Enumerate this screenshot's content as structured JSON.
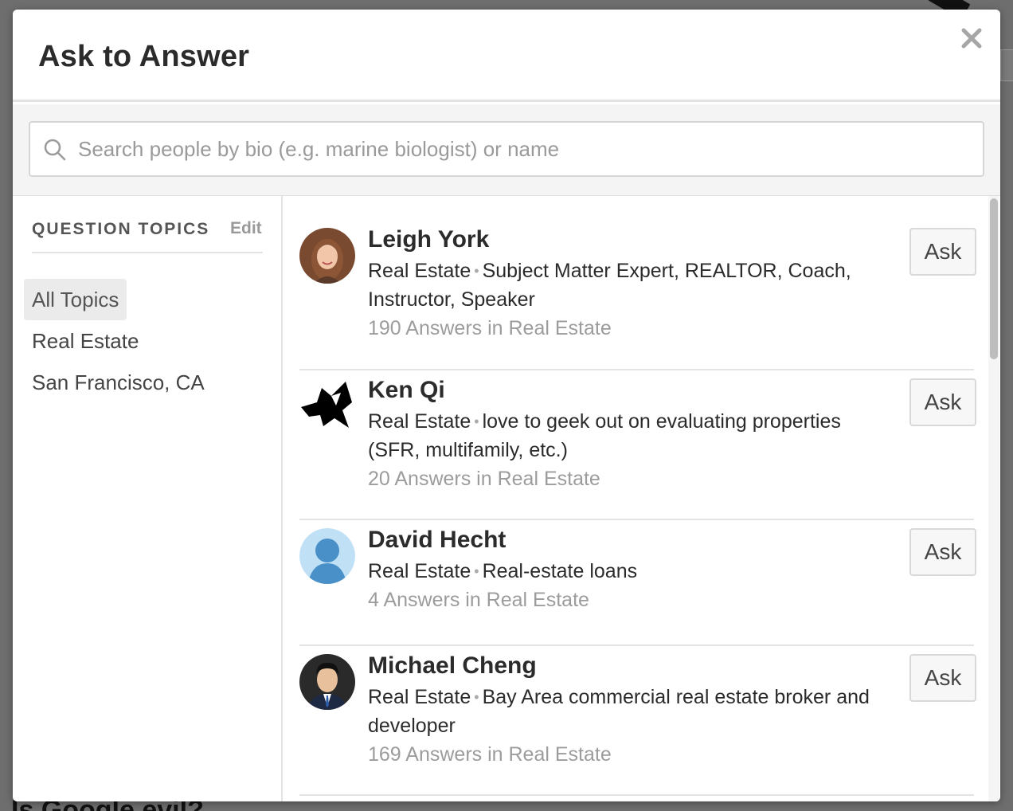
{
  "dialog": {
    "title": "Ask to Answer"
  },
  "search": {
    "placeholder": "Search people by bio (e.g. marine biologist) or name",
    "value": ""
  },
  "sidebar": {
    "heading": "QUESTION TOPICS",
    "edit_label": "Edit",
    "topics": [
      {
        "label": "All Topics",
        "selected": true
      },
      {
        "label": "Real Estate",
        "selected": false
      },
      {
        "label": "San Francisco, CA",
        "selected": false
      }
    ]
  },
  "people": [
    {
      "name": "Leigh York",
      "topic": "Real Estate",
      "bio": "Subject Matter Expert, REALTOR, Coach, Instructor, Speaker",
      "stats": "190 Answers in Real Estate",
      "action": "Ask",
      "avatar": "photo-woman"
    },
    {
      "name": "Ken Qi",
      "topic": "Real Estate",
      "bio": "love to geek out on evaluating properties (SFR, multifamily, etc.)",
      "stats": "20 Answers in Real Estate",
      "action": "Ask",
      "avatar": "bird-logo"
    },
    {
      "name": "David Hecht",
      "topic": "Real Estate",
      "bio": "Real-estate loans",
      "stats": "4 Answers in Real Estate",
      "action": "Ask",
      "avatar": "default-silhouette"
    },
    {
      "name": "Michael Cheng",
      "topic": "Real Estate",
      "bio": "Bay Area commercial real estate broker and developer",
      "stats": "169 Answers in Real Estate",
      "action": "Ask",
      "avatar": "photo-man"
    }
  ],
  "background": {
    "question_title": "Is Google evil?"
  },
  "colors": {
    "overlay": "#6e6e6e",
    "muted_text": "#9c9c9c",
    "selected_topic_bg": "#ebebeb",
    "default_avatar_bg": "#bfe0f5",
    "default_avatar_fg": "#4a90c8"
  }
}
